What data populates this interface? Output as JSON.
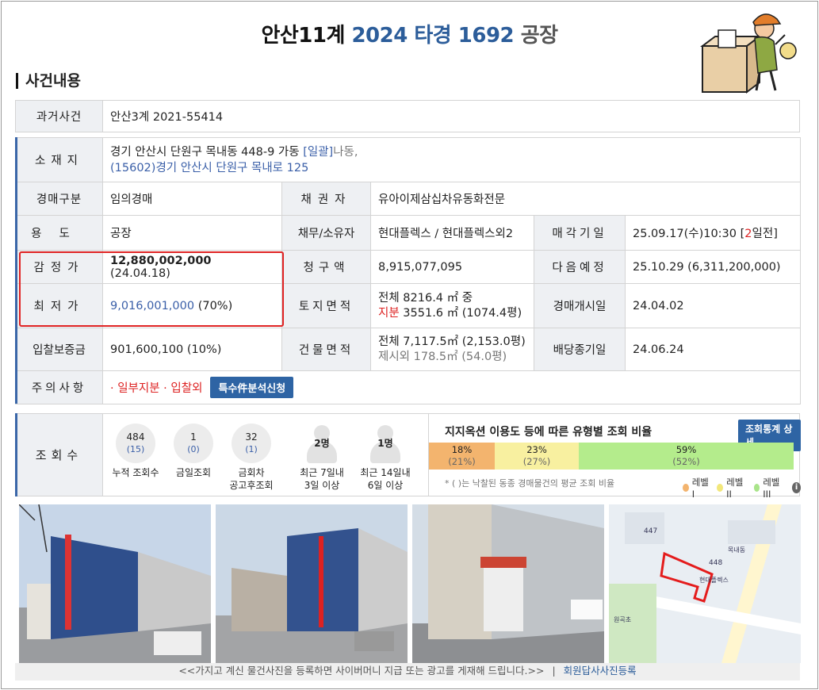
{
  "header": {
    "court": "안산11계",
    "case_no": "2024 타경 1692",
    "type": "공장"
  },
  "section_title": "사건내용",
  "past_case": {
    "label": "과거사건",
    "value": "안산3계 2021-55414"
  },
  "location": {
    "label": "소재지",
    "line1_prefix": "경기 안산시 단원구 목내동 448-9 가동 ",
    "line1_tag": "[일괄]",
    "line1_suffix": "나동,",
    "line2": "(15602)경기 안산시 단원구 목내로 125"
  },
  "auction_type": {
    "label": "경매구분",
    "value": "임의경매"
  },
  "creditor": {
    "label": "채권자",
    "value": "유아이제삼십차유동화전문"
  },
  "usage": {
    "label": "용도",
    "value": "공장"
  },
  "debtor": {
    "label": "채무/소유자",
    "value": "현대플렉스 /  현대플렉스외2"
  },
  "sale_date": {
    "label": "매각기일",
    "value_prefix": "25.09.17(수)10:30 [",
    "value_num": "2",
    "value_suffix": "일전]"
  },
  "appraisal": {
    "label": "감정가",
    "amount": "12,880,002,000",
    "date": "(24.04.18)"
  },
  "claim": {
    "label": "청구액",
    "value": "8,915,077,095"
  },
  "next_sale": {
    "label": "다음예정",
    "value": "25.10.29 (6,311,200,000)"
  },
  "minimum": {
    "label": "최저가",
    "amount": "9,016,001,000",
    "pct": "(70%)"
  },
  "land_area": {
    "label": "토지면적",
    "line1": "전체 8216.4 ㎡ 중",
    "line2_tag": "지분",
    "line2_val": " 3551.6 ㎡ (1074.4평)"
  },
  "start_date": {
    "label": "경매개시일",
    "value": "24.04.02"
  },
  "deposit": {
    "label": "입찰보증금",
    "value": "901,600,100 (10%)"
  },
  "building_area": {
    "label": "건물면적",
    "line1": "전체 7,117.5㎡ (2,153.0평)",
    "line2": "제시외 178.5㎡ (54.0평)"
  },
  "dividend_date": {
    "label": "배당종기일",
    "value": "24.06.24"
  },
  "notice": {
    "label": "주의사항",
    "value": "· 일부지분 · 입찰외",
    "button": "특수件분석신청"
  },
  "views": {
    "label": "조회수",
    "stats": [
      {
        "num": "484",
        "sub": "(15)",
        "caption1": "누적 조회수",
        "caption2": ""
      },
      {
        "num": "1",
        "sub": "(0)",
        "caption1": "금일조회",
        "caption2": ""
      },
      {
        "num": "32",
        "sub": "(1)",
        "caption1": "금회차",
        "caption2": "공고후조회"
      },
      {
        "num": "2명",
        "sub": "",
        "caption1": "최근 7일내",
        "caption2": "3일 이상"
      },
      {
        "num": "1명",
        "sub": "",
        "caption1": "최근 14일내",
        "caption2": "6일 이상"
      }
    ],
    "ratio_title": "지지옥션 이용도 등에 따른 유형별 조회 비율",
    "ratio_button": "조회통계 상세",
    "bars": [
      {
        "pct": "18%",
        "sub": "(21%)",
        "fraction": 0.18,
        "color": "#f3b46e"
      },
      {
        "pct": "23%",
        "sub": "(27%)",
        "fraction": 0.23,
        "color": "#f8f0a0"
      },
      {
        "pct": "59%",
        "sub": "(52%)",
        "fraction": 0.59,
        "color": "#b4ec8c"
      }
    ],
    "note": "* ( )는 낙찰된 동종 경매물건의 평균 조회 비율",
    "legend": [
      "레벨 I",
      "레벨 II",
      "레벨 III"
    ],
    "legend_colors": [
      "#f3b46e",
      "#f2e77a",
      "#a9e48a"
    ]
  },
  "map_labels": [
    "447",
    "448",
    "현대플렉스",
    "원곡초",
    "목내동"
  ],
  "caption_text": "<<가지고 계신 물건사진을 등록하면 사이버머니 지급 또는 광고를 게재해 드립니다.>>",
  "caption_link": "회원답사사진등록"
}
